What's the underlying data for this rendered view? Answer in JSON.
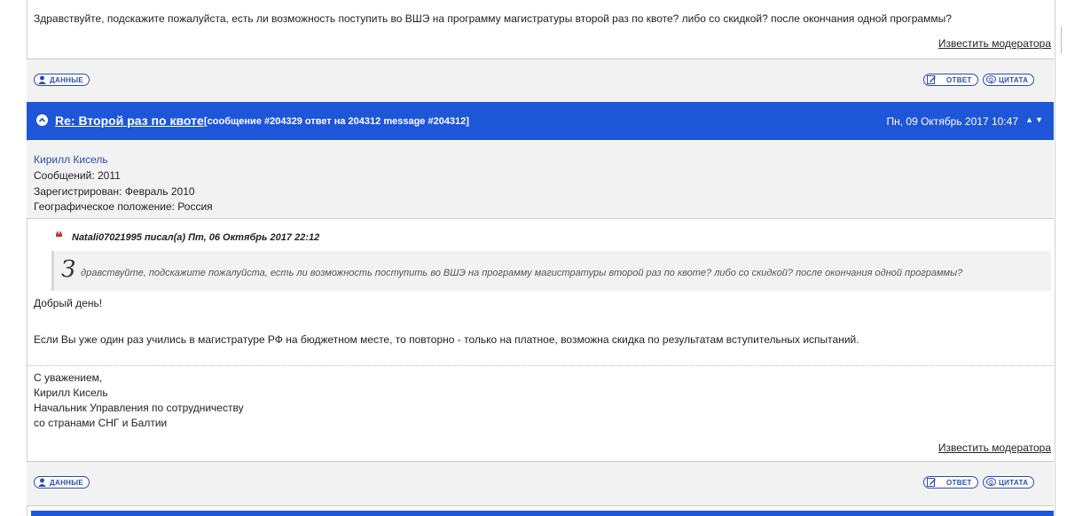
{
  "post1": {
    "text": "Здравствуйте, подскажите пожалуйста, есть ли возможность поступить во ВШЭ на программу магистратуры второй раз по квоте? либо со скидкой? после окончания одной программы?",
    "report_link": "Известить модератора"
  },
  "actions": {
    "profile_label": "ДАННЫЕ",
    "reply_label": "ОТВЕТ",
    "quote_label": "ЦИТАТА"
  },
  "post2": {
    "title": "Re: Второй раз по квоте",
    "meta": "[сообщение #204329 ответ на 204312 message #204312]",
    "date": "Пн, 09 Октябрь 2017 10:47",
    "author": "Кирилл Кисель",
    "posts": "Сообщений: 2011",
    "registered": "Зарегистрирован: Февраль 2010",
    "location": "Географическое положение: Россия",
    "quote_author": "Natali07021995 писал(а) Пт, 06 Октябрь 2017 22:12",
    "quote_initial": "З",
    "quote_text": "дравствуйте, подскажите пожалуйста, есть ли возможность поступить во ВШЭ на программу магистратуры второй раз по квоте? либо со скидкой? после окончания одной программы?",
    "greeting": "Добрый день!",
    "body": "Если Вы уже один раз учились в магистратуре РФ на бюджетном месте, то повторно - только на платное, возможна скидка по результатам вступительных испытаний.",
    "sig_line1": "С уважением,",
    "sig_line2": "Кирилл Кисель",
    "sig_line3": "Начальник Управления по сотрудничеству",
    "sig_line4": "со странами СНГ и Балтии",
    "report_link": "Известить модератора"
  },
  "colors": {
    "header_blue": "#1e56d8",
    "link_blue": "#2a4ea8",
    "quote_red": "#c0392b",
    "panel_gray": "#f2f2f2"
  }
}
